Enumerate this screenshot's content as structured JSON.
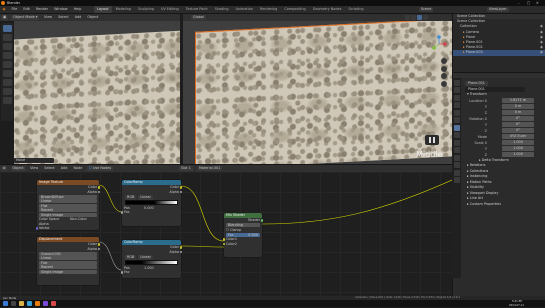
{
  "window": {
    "title": "Blender",
    "controls": [
      "–",
      "□",
      "✕"
    ]
  },
  "menus": [
    "File",
    "Edit",
    "Render",
    "Window",
    "Help"
  ],
  "workspaces": [
    "Layout",
    "Modeling",
    "Sculpting",
    "UV Editing",
    "Texture Paint",
    "Shading",
    "Animation",
    "Rendering",
    "Compositing",
    "Geometry Nodes",
    "Scripting"
  ],
  "scene": {
    "name": "Scene",
    "view_layer": "ViewLayer"
  },
  "viewport": {
    "mode": "Object Mode",
    "menus": [
      "View",
      "Select",
      "Add",
      "Object"
    ],
    "transform": "Global",
    "overlay_text": "Middle",
    "footer_label": "Move"
  },
  "node_editor": {
    "type": "Object",
    "menus": [
      "View",
      "Select",
      "Add",
      "Node"
    ],
    "use_nodes_label": "Use Nodes",
    "slot": "Slot 1",
    "material": "Material.001",
    "nodes": {
      "tex_a": {
        "title": "Image Texture",
        "outputs": [
          "Color",
          "Alpha"
        ],
        "image": "BrownDiffuse",
        "rows": [
          "Linear",
          "Flat",
          "Repeat",
          "Single Image",
          "Color Space",
          "Alpha"
        ],
        "extra": "Non-Color",
        "vector": "Vector"
      },
      "ramp_a": {
        "title": "ColorRamp",
        "outputs": [
          "Color",
          "Alpha"
        ],
        "mode": "RGB",
        "interp": "Linear",
        "pos_label": "Pos",
        "pos": "0.000",
        "fac": "Fac"
      },
      "mix": {
        "title": "Mix Shader",
        "outputs": [
          "Shader"
        ],
        "rows": [
          "Blending",
          "Clamp",
          "Fac",
          "Color1",
          "Color2"
        ],
        "fac_val": "0.500"
      },
      "tex_b": {
        "title": "Displacement",
        "outputs": [
          "Color",
          "Alpha"
        ],
        "image": "Ground.001",
        "rows": [
          "Linear",
          "Flat",
          "Repeat",
          "Single Image"
        ]
      },
      "ramp_b": {
        "title": "ColorRamp",
        "outputs": [
          "Color",
          "Alpha"
        ],
        "mode": "RGB",
        "interp": "Linear",
        "pos": "1.000",
        "fac": "Fac"
      }
    }
  },
  "outliner": {
    "title": "Scene Collection",
    "items": [
      {
        "name": "Scene Collection",
        "indent": 0
      },
      {
        "name": "Collection",
        "indent": 1
      },
      {
        "name": "Camera",
        "indent": 2
      },
      {
        "name": "Plane",
        "indent": 2
      },
      {
        "name": "Plane.001",
        "indent": 2
      },
      {
        "name": "Plane.002",
        "indent": 2
      },
      {
        "name": "Plane.003",
        "indent": 2
      }
    ],
    "selected_index": 6
  },
  "properties": {
    "object_name": "Plane.001",
    "data_name": "Plane.001",
    "section": "Transform",
    "location_label": "Location X",
    "location": [
      "1.8171 m",
      "0 m",
      "0 m"
    ],
    "rotation_label": "Rotation X",
    "rotation": [
      "0°",
      "0°",
      "0°"
    ],
    "mode_label": "Mode",
    "mode_value": "XYZ Euler",
    "scale_label": "Scale X",
    "scale": [
      "1.000",
      "1.000",
      "1.000"
    ],
    "axis_labels": [
      "Y",
      "Z"
    ],
    "groups": [
      "Delta Transform",
      "Relations",
      "Collections",
      "Instancing",
      "Motion Paths",
      "Visibility",
      "Viewport Display",
      "Line Art",
      "Custom Properties"
    ]
  },
  "status": {
    "left": "Join Node",
    "right": "Collection | Plane.001 | Verts 1,316 | Faces 2,516 | Tris 5,032 | Objects 1/4 | 3.6.1"
  },
  "taskbar": {
    "time": "5:21 PM",
    "date": "2024-07-11"
  },
  "colors": {
    "accent": "#4a6a96",
    "selection_outline": "#e06a1b",
    "texture_header": "#7a4a25",
    "converter_header": "#2b6c8c",
    "shader_header": "#3f6f3f",
    "link_yellow": "#d9d900",
    "link_grey": "#9b9b9b"
  }
}
